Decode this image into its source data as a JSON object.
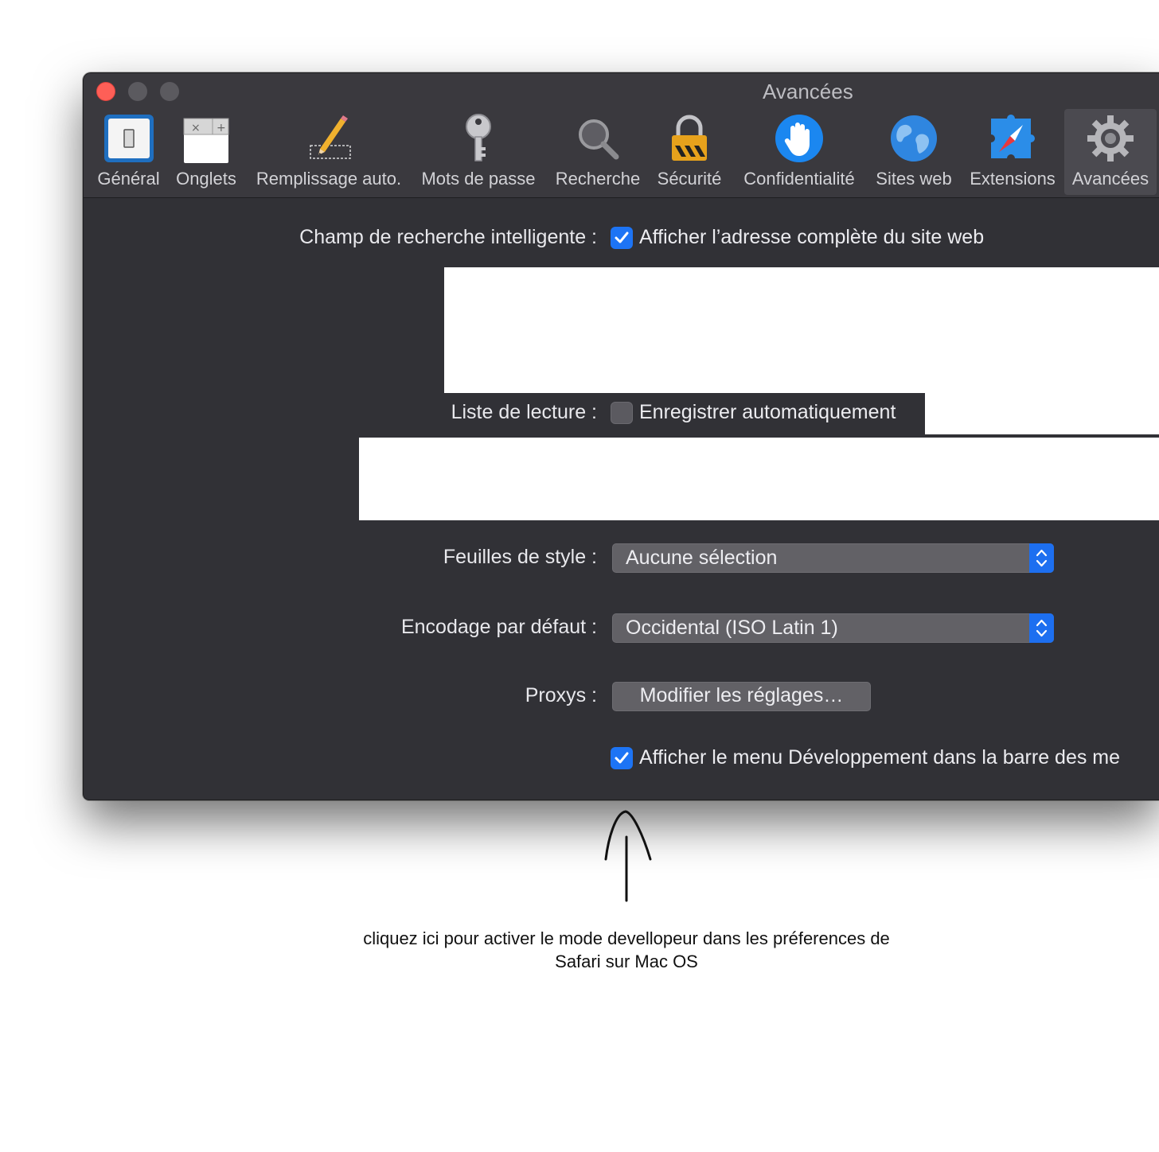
{
  "window": {
    "title": "Avancées",
    "toolbar": [
      {
        "label": "Général",
        "icon": "general-switch-icon"
      },
      {
        "label": "Onglets",
        "icon": "tabs-icon"
      },
      {
        "label": "Remplissage auto.",
        "icon": "autofill-pencil-icon"
      },
      {
        "label": "Mots de passe",
        "icon": "key-icon"
      },
      {
        "label": "Recherche",
        "icon": "magnifier-icon"
      },
      {
        "label": "Sécurité",
        "icon": "padlock-icon"
      },
      {
        "label": "Confidentialité",
        "icon": "hand-icon"
      },
      {
        "label": "Sites web",
        "icon": "globe-icon"
      },
      {
        "label": "Extensions",
        "icon": "puzzle-compass-icon"
      },
      {
        "label": "Avancées",
        "icon": "gear-icon"
      }
    ],
    "selected_tab": "Avancées"
  },
  "settings": {
    "smart_search_label": "Champ de recherche intelligente :",
    "smart_search_option": "Afficher l’adresse complète du site web",
    "smart_search_checked": true,
    "reading_list_label": "Liste de lecture :",
    "reading_list_option": "Enregistrer automatiquement",
    "reading_list_checked": false,
    "stylesheet_label": "Feuilles de style :",
    "stylesheet_value": "Aucune sélection",
    "encoding_label": "Encodage par défaut :",
    "encoding_value": "Occidental (ISO Latin 1)",
    "proxies_label": "Proxys :",
    "proxies_button": "Modifier les réglages…",
    "develop_menu_option": "Afficher le menu Développement dans la barre des me",
    "develop_menu_checked": true
  },
  "annotation": {
    "line1": "cliquez ici pour activer le mode devellopeur dans les préferences de",
    "line2": "Safari sur Mac OS"
  },
  "colors": {
    "window_bg": "#313136",
    "accent": "#1d74f5",
    "close": "#fe5f57"
  }
}
